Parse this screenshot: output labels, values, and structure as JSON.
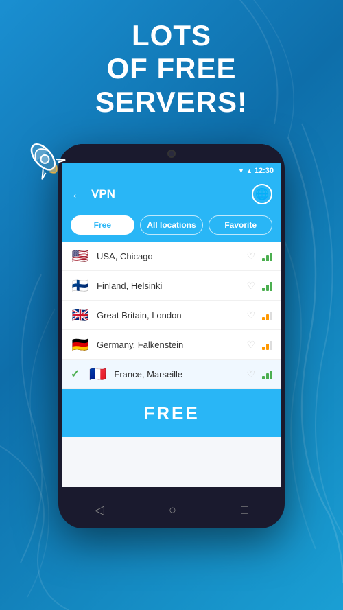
{
  "background": {
    "gradient_start": "#1a8fd1",
    "gradient_end": "#0e6eaa"
  },
  "headline": {
    "line1": "Lots",
    "line2": "of free",
    "line3": "servers!"
  },
  "status_bar": {
    "time": "12:30",
    "signal_icon": "▲",
    "wifi_icon": "▼"
  },
  "app_header": {
    "title": "VPN",
    "back_icon": "←",
    "globe_icon": "🌐"
  },
  "tabs": [
    {
      "label": "Free",
      "active": true
    },
    {
      "label": "All locations",
      "active": false
    },
    {
      "label": "Favorite",
      "active": false
    }
  ],
  "servers": [
    {
      "country": "USA, Chicago",
      "flag": "🇺🇸",
      "signal": 3,
      "selected": false,
      "favorited": false
    },
    {
      "country": "Finland, Helsinki",
      "flag": "🇫🇮",
      "signal": 3,
      "selected": false,
      "favorited": false
    },
    {
      "country": "Great Britain, London",
      "flag": "🇬🇧",
      "signal": 2,
      "selected": false,
      "favorited": false
    },
    {
      "country": "Germany, Falkenstein",
      "flag": "🇩🇪",
      "signal": 2,
      "selected": false,
      "favorited": false
    },
    {
      "country": "France, Marseille",
      "flag": "🇫🇷",
      "signal": 3,
      "selected": true,
      "favorited": false
    }
  ],
  "free_label": "FREE",
  "nav": {
    "back": "◁",
    "home": "○",
    "recents": "□"
  }
}
